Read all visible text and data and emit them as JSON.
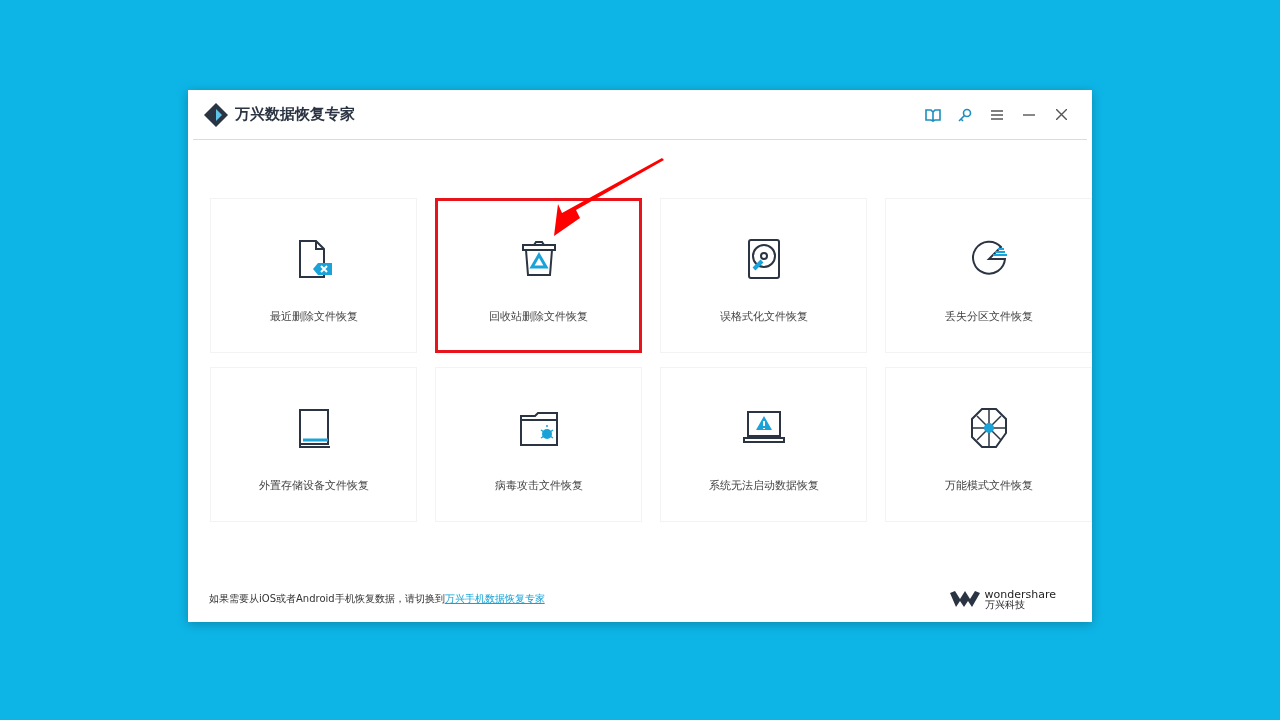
{
  "window": {
    "title": "万兴数据恢复专家"
  },
  "cards": [
    {
      "kind": "recent",
      "label": "最近删除文件恢复",
      "highlighted": false
    },
    {
      "kind": "recycle",
      "label": "回收站删除文件恢复",
      "highlighted": true
    },
    {
      "kind": "format",
      "label": "误格式化文件恢复",
      "highlighted": false
    },
    {
      "kind": "partition",
      "label": "丢失分区文件恢复",
      "highlighted": false
    },
    {
      "kind": "external",
      "label": "外置存储设备文件恢复",
      "highlighted": false
    },
    {
      "kind": "virus",
      "label": "病毒攻击文件恢复",
      "highlighted": false
    },
    {
      "kind": "system",
      "label": "系统无法启动数据恢复",
      "highlighted": false
    },
    {
      "kind": "all",
      "label": "万能模式文件恢复",
      "highlighted": false
    }
  ],
  "footer": {
    "note": "如果需要从iOS或者Android手机恢复数据，请切换到",
    "link": "万兴手机数据恢复专家"
  },
  "brand": {
    "name": "wondershare",
    "sub": "万兴科技"
  }
}
